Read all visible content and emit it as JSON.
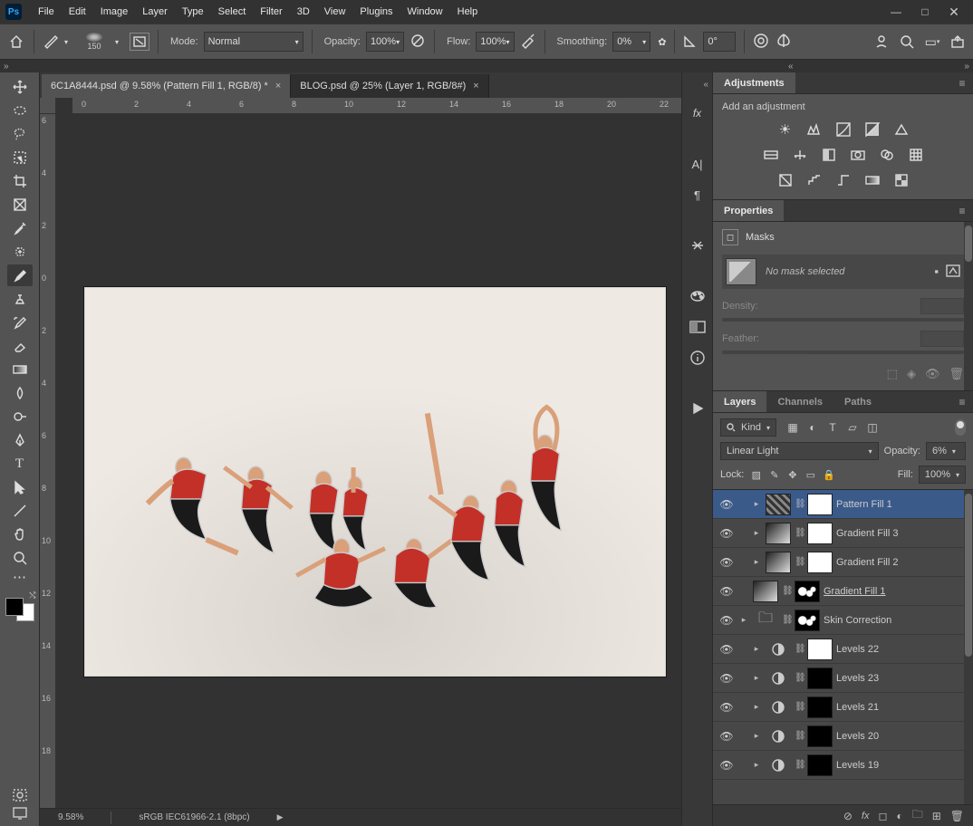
{
  "menubar": [
    "File",
    "Edit",
    "Image",
    "Layer",
    "Type",
    "Select",
    "Filter",
    "3D",
    "View",
    "Plugins",
    "Window",
    "Help"
  ],
  "options": {
    "brush_size": "150",
    "mode_label": "Mode:",
    "mode_value": "Normal",
    "opacity_label": "Opacity:",
    "opacity_value": "100%",
    "flow_label": "Flow:",
    "flow_value": "100%",
    "smoothing_label": "Smoothing:",
    "smoothing_value": "0%",
    "angle_value": "0°"
  },
  "tabs": [
    {
      "label": "6C1A8444.psd @ 9.58% (Pattern Fill 1, RGB/8) *",
      "active": true
    },
    {
      "label": "BLOG.psd @ 25% (Layer 1, RGB/8#)",
      "active": false
    }
  ],
  "rulers": {
    "h": [
      "0",
      "2",
      "4",
      "6",
      "8",
      "10",
      "12",
      "14",
      "16",
      "18",
      "20",
      "22"
    ],
    "v": [
      "6",
      "4",
      "2",
      "0",
      "2",
      "4",
      "6",
      "8",
      "10",
      "12",
      "14",
      "16",
      "18"
    ]
  },
  "status": {
    "zoom": "9.58%",
    "profile": "sRGB IEC61966-2.1 (8bpc)"
  },
  "adjustments": {
    "panel": "Adjustments",
    "add_label": "Add an adjustment"
  },
  "properties": {
    "panel": "Properties",
    "section": "Masks",
    "no_mask": "No mask selected",
    "density": "Density:",
    "feather": "Feather:"
  },
  "layers_panel": {
    "tabs": [
      "Layers",
      "Channels",
      "Paths"
    ],
    "kind_label": "Kind",
    "blend_mode": "Linear Light",
    "opacity_label": "Opacity:",
    "opacity_value": "6%",
    "lock_label": "Lock:",
    "fill_label": "Fill:",
    "fill_value": "100%"
  },
  "layers": [
    {
      "name": "Pattern Fill 1",
      "type": "pattern",
      "mask": "white",
      "selected": true,
      "indent": 1
    },
    {
      "name": "Gradient Fill 3",
      "type": "grad",
      "mask": "white",
      "indent": 1
    },
    {
      "name": "Gradient Fill 2",
      "type": "grad",
      "mask": "white",
      "indent": 1
    },
    {
      "name": "Gradient Fill 1",
      "type": "grad",
      "mask": "splatter",
      "underline": true,
      "indent": 0
    },
    {
      "name": "Skin Correction",
      "type": "folder",
      "mask": "splatter",
      "indent": 0,
      "folder": true
    },
    {
      "name": "Levels 22",
      "type": "adj",
      "mask": "white",
      "indent": 1
    },
    {
      "name": "Levels 23",
      "type": "adj",
      "mask": "dark",
      "indent": 1
    },
    {
      "name": "Levels 21",
      "type": "adj",
      "mask": "dark",
      "indent": 1
    },
    {
      "name": "Levels 20",
      "type": "adj",
      "mask": "dark",
      "indent": 1
    },
    {
      "name": "Levels 19",
      "type": "adj",
      "mask": "dark",
      "indent": 1
    }
  ]
}
